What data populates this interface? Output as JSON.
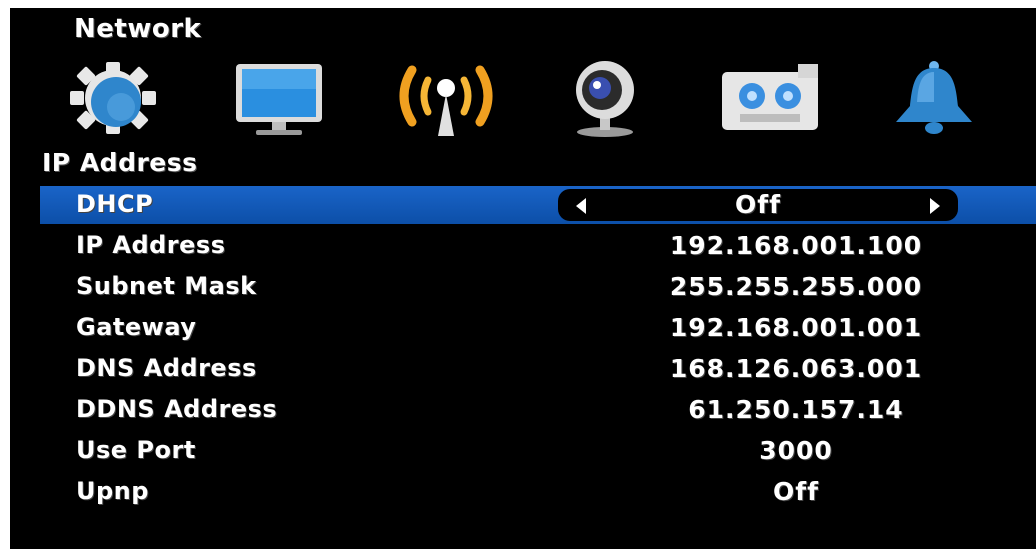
{
  "menu": {
    "title": "Network",
    "icons": [
      "system-gear-icon",
      "display-monitor-icon",
      "network-antenna-icon",
      "camera-icon",
      "recording-tape-icon",
      "alarm-bell-icon"
    ],
    "active_icon": "network-antenna-icon"
  },
  "section": {
    "title": "IP Address"
  },
  "settings": [
    {
      "label": "DHCP",
      "value": "Off"
    },
    {
      "label": "IP Address",
      "value": "192.168.001.100"
    },
    {
      "label": "Subnet Mask",
      "value": "255.255.255.000"
    },
    {
      "label": "Gateway",
      "value": "192.168.001.001"
    },
    {
      "label": "DNS Address",
      "value": "168.126.063.001"
    },
    {
      "label": "DDNS Address",
      "value": "61.250.157.14"
    },
    {
      "label": "Use Port",
      "value": "3000"
    },
    {
      "label": "Upnp",
      "value": "Off"
    }
  ],
  "colors": {
    "background": "#000000",
    "selection": "#1a64c8",
    "active_icon": "#f0a020",
    "text": "#ffffff"
  }
}
